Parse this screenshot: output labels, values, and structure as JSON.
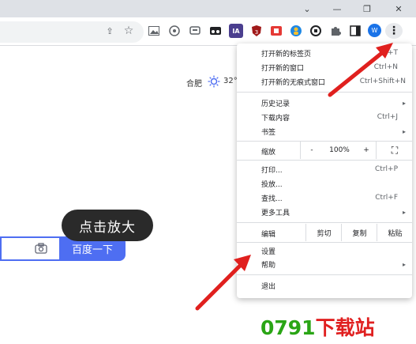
{
  "window": {
    "controls": [
      {
        "name": "minimize-button",
        "glyph": "⌄"
      },
      {
        "name": "minimize-window-button",
        "glyph": "—"
      },
      {
        "name": "restore-button",
        "glyph": "❐"
      },
      {
        "name": "close-window-button",
        "glyph": "✕"
      }
    ]
  },
  "toolbar": {
    "share_glyph": "⇪",
    "star_glyph": "☆",
    "ext_ia_label": "IA",
    "ext_badge": "3",
    "profile_initial": "W",
    "menu_glyph": "⋮"
  },
  "page": {
    "city": "合肥",
    "temperature": "32°",
    "search_button_label": "百度一下",
    "tooltip": "点击放大",
    "camera_glyph": "◎"
  },
  "menu": {
    "new_tab": {
      "label": "打开新的标签页",
      "shortcut": "+T"
    },
    "new_window": {
      "label": "打开新的窗口",
      "shortcut": "Ctrl+N"
    },
    "incognito": {
      "label": "打开新的无痕式窗口",
      "shortcut": "Ctrl+Shift+N"
    },
    "history": {
      "label": "历史记录"
    },
    "downloads": {
      "label": "下载内容",
      "shortcut": "Ctrl+J"
    },
    "bookmarks": {
      "label": "书签"
    },
    "zoom": {
      "label": "缩放",
      "minus": "-",
      "value": "100%",
      "plus": "+",
      "fullscreen": "⛶"
    },
    "print": {
      "label": "打印...",
      "shortcut": "Ctrl+P"
    },
    "cast": {
      "label": "投放..."
    },
    "find": {
      "label": "查找...",
      "shortcut": "Ctrl+F"
    },
    "more_tools": {
      "label": "更多工具"
    },
    "edit": {
      "label": "编辑",
      "cut": "剪切",
      "copy": "复制",
      "paste": "粘贴"
    },
    "settings": {
      "label": "设置"
    },
    "help": {
      "label": "帮助"
    },
    "exit": {
      "label": "退出"
    },
    "submenu_arrow": "▸"
  },
  "watermark": {
    "prefix": "0791",
    "suffix": "下载站"
  },
  "colors": {
    "accent": "#4e6ef2",
    "arrow": "#e0201e",
    "watermark_green": "#2aa515",
    "watermark_red": "#e02020"
  }
}
